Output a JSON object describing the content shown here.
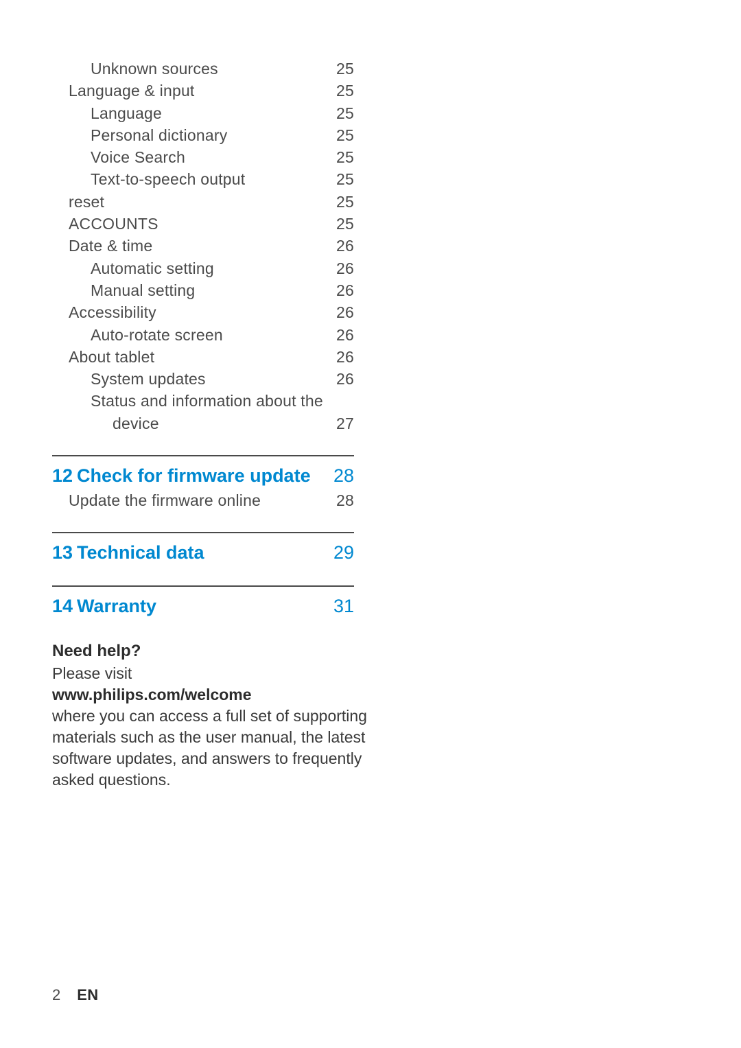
{
  "toc_flat": [
    {
      "level": 2,
      "label": "Unknown sources",
      "page": "25"
    },
    {
      "level": 1,
      "label": "Language & input",
      "page": "25"
    },
    {
      "level": 2,
      "label": "Language",
      "page": "25"
    },
    {
      "level": 2,
      "label": "Personal dictionary",
      "page": "25"
    },
    {
      "level": 2,
      "label": "Voice Search",
      "page": "25"
    },
    {
      "level": 2,
      "label": "Text-to-speech output",
      "page": "25"
    },
    {
      "level": 1,
      "label": "reset",
      "page": "25"
    },
    {
      "level": 1,
      "label": "ACCOUNTS",
      "page": "25"
    },
    {
      "level": 1,
      "label": "Date & time",
      "page": "26"
    },
    {
      "level": 2,
      "label": "Automatic setting",
      "page": "26"
    },
    {
      "level": 2,
      "label": "Manual setting",
      "page": "26"
    },
    {
      "level": 1,
      "label": "Accessibility",
      "page": "26"
    },
    {
      "level": 2,
      "label": "Auto-rotate screen",
      "page": "26"
    },
    {
      "level": 1,
      "label": "About tablet",
      "page": "26"
    },
    {
      "level": 2,
      "label": "System updates",
      "page": "26"
    },
    {
      "level": 2,
      "label": "Status and information about the device",
      "page": "27"
    }
  ],
  "sections": [
    {
      "num": "12",
      "title": "Check for firmware update",
      "page": "28",
      "subs": [
        {
          "label": "Update the firmware online",
          "page": "28"
        }
      ]
    },
    {
      "num": "13",
      "title": "Technical data",
      "page": "29",
      "subs": []
    },
    {
      "num": "14",
      "title": "Warranty",
      "page": "31",
      "subs": []
    }
  ],
  "help": {
    "heading": "Need help?",
    "line1": "Please visit",
    "link": "www.philips.com/welcome",
    "body": "where you can access a full set of supporting materials such as the user manual, the latest software updates, and answers to frequently asked questions."
  },
  "footer": {
    "page_number": "2",
    "lang": "EN"
  }
}
